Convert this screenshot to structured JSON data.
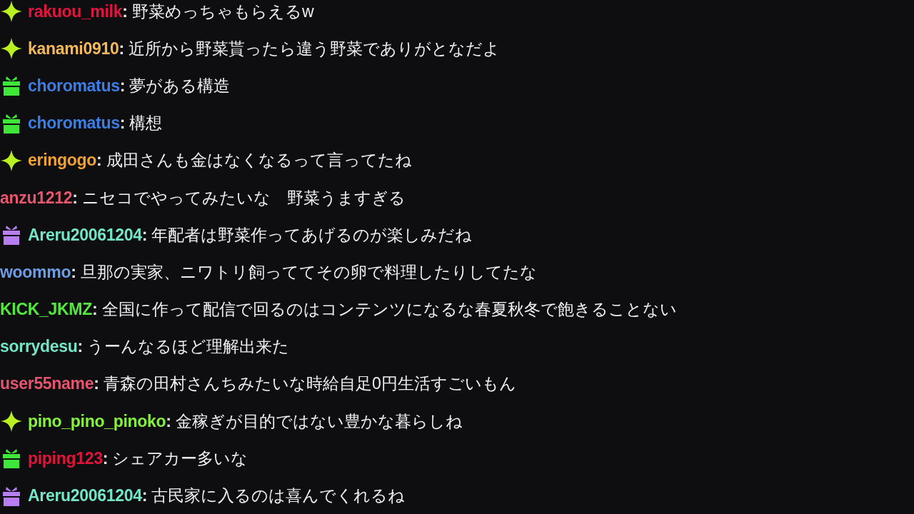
{
  "messages": [
    {
      "badge": {
        "kind": "sparkle"
      },
      "user": "rakuou_milk",
      "color": "#e0163e",
      "separator": ":",
      "text": "野菜めっちゃもらえるw"
    },
    {
      "badge": {
        "kind": "sparkle"
      },
      "user": "kanami0910",
      "color": "#f2b85a",
      "separator": ":",
      "text": "近所から野菜貰ったら違う野菜でありがとなだよ"
    },
    {
      "badge": {
        "kind": "gift",
        "color": "#3ee63a"
      },
      "user": "choromatus",
      "color": "#3a7ee6",
      "separator": ":",
      "text": "夢がある構造"
    },
    {
      "badge": {
        "kind": "gift",
        "color": "#3ee63a"
      },
      "user": "choromatus",
      "color": "#3a7ee6",
      "separator": ":",
      "text": "構想"
    },
    {
      "badge": {
        "kind": "sparkle"
      },
      "user": "eringogo",
      "color": "#f2a232",
      "separator": ":",
      "text": "成田さんも金はなくなるって言ってたね"
    },
    {
      "user": "anzu1212",
      "color": "#e8566e",
      "separator": ":",
      "text": "ニセコでやってみたいな　野菜うますぎる"
    },
    {
      "badge": {
        "kind": "gift",
        "color": "#b67ef0"
      },
      "user": "Areru20061204",
      "color": "#72e6c6",
      "separator": ":",
      "text": "年配者は野菜作ってあげるのが楽しみだね"
    },
    {
      "user": "woommo",
      "color": "#6c9ee8",
      "separator": ":",
      "text": "旦那の実家、ニワトリ飼っててその卵で料理したりしてたな"
    },
    {
      "user": "KICK_JKMZ",
      "color": "#52e63e",
      "separator": ":",
      "text": "全国に作って配信で回るのはコンテンツになるな春夏秋冬で飽きることない"
    },
    {
      "user": "sorrydesu",
      "color": "#72e6c6",
      "separator": ":",
      "text": "うーんなるほど理解出来た"
    },
    {
      "user": "user55name",
      "color": "#e4546e",
      "separator": ":",
      "text": "青森の田村さんちみたいな時給自足0円生活すごいもん"
    },
    {
      "badge": {
        "kind": "sparkle"
      },
      "user": "pino_pino_pinoko",
      "color": "#86f23e",
      "separator": ":",
      "text": "金稼ぎが目的ではない豊かな暮らしね"
    },
    {
      "badge": {
        "kind": "gift",
        "color": "#3ee63a"
      },
      "user": "piping123",
      "color": "#e0143a",
      "separator": ":",
      "text": "シェアカー多いな"
    },
    {
      "badge": {
        "kind": "gift",
        "color": "#b67ef0"
      },
      "user": "Areru20061204",
      "color": "#72e6c6",
      "separator": ":",
      "text": "古民家に入るのは喜んでくれるね"
    }
  ]
}
